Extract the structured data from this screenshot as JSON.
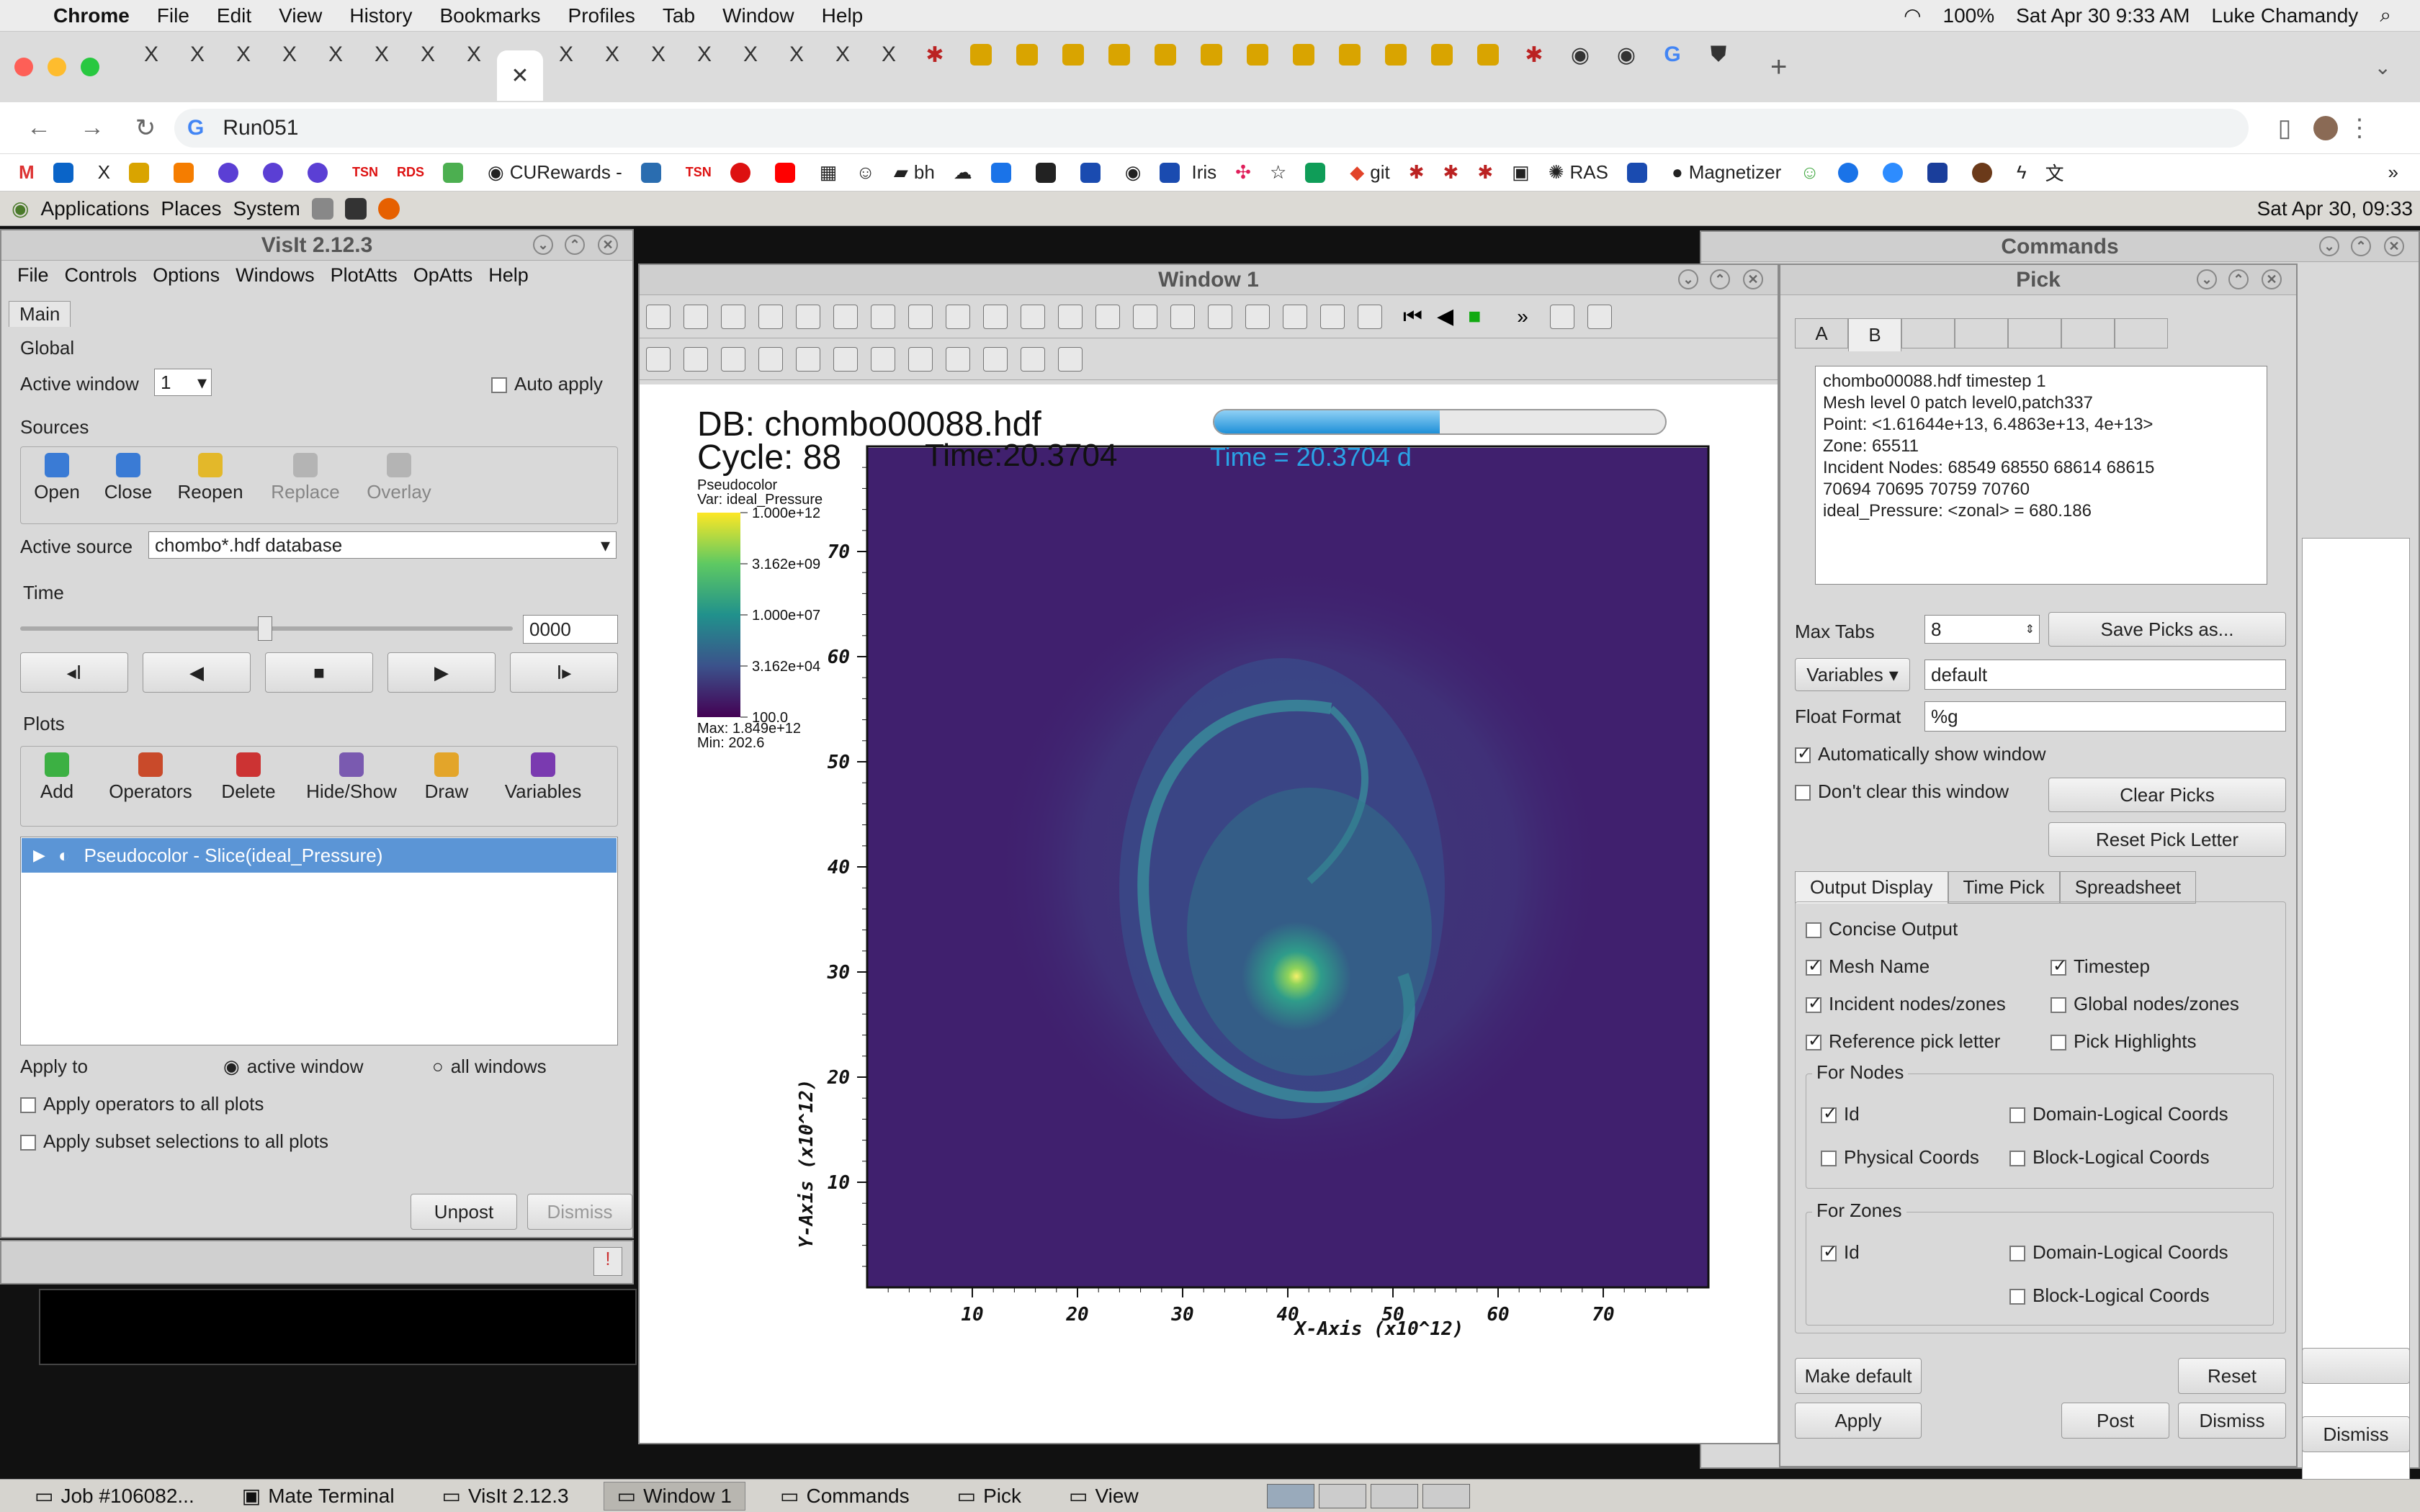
{
  "mac": {
    "menus": [
      "Chrome",
      "File",
      "Edit",
      "View",
      "History",
      "Bookmarks",
      "Profiles",
      "Tab",
      "Window",
      "Help"
    ],
    "battery": "100%",
    "datetime": "Sat Apr 30  9:33 AM",
    "user": "Luke Chamandy"
  },
  "browser": {
    "url": "Run051",
    "bookmarks": [
      "CURewards -",
      "bh",
      "Iris",
      "git",
      "RAS",
      "Magnetizer"
    ]
  },
  "mate": {
    "menus": [
      "Applications",
      "Places",
      "System"
    ],
    "clock": "Sat Apr 30, 09:33"
  },
  "visit": {
    "title": "VisIt 2.12.3",
    "menus": [
      "File",
      "Controls",
      "Options",
      "Windows",
      "PlotAtts",
      "OpAtts",
      "Help"
    ],
    "tab": "Main",
    "global": "Global",
    "active_window_label": "Active window",
    "active_window_value": "1",
    "auto_apply": "Auto apply",
    "sources": "Sources",
    "src_buttons": [
      "Open",
      "Close",
      "Reopen",
      "Replace",
      "Overlay"
    ],
    "active_source_label": "Active source",
    "active_source_value": "chombo*.hdf database",
    "time": "Time",
    "time_value": "0000",
    "plots": "Plots",
    "plot_buttons": [
      "Add",
      "Operators",
      "Delete",
      "Hide/Show",
      "Draw",
      "Variables"
    ],
    "plot_item": "Pseudocolor - Slice(ideal_Pressure)",
    "apply_to": "Apply to",
    "active_window": "active window",
    "all_windows": "all windows",
    "apply_ops": "Apply operators to all plots",
    "apply_subset": "Apply subset selections to all plots",
    "unpost": "Unpost",
    "dismiss": "Dismiss"
  },
  "window1": {
    "title": "Window 1",
    "db": "DB: chombo00088.hdf",
    "cycle": "Cycle: 88",
    "time_label": "Time:20.3704",
    "time_text": "Time = 20.3704 d",
    "legend_title": "Pseudocolor",
    "legend_var": "Var: ideal_Pressure",
    "legend_ticks": [
      "1.000e+12",
      "3.162e+09",
      "1.000e+07",
      "3.162e+04",
      "100.0"
    ],
    "legend_max": "Max: 1.849e+12",
    "legend_min": "Min: 202.6",
    "xlabel": "X-Axis  (x10^12)",
    "ylabel": "Y-Axis  (x10^12)",
    "xticks": [
      "10",
      "20",
      "30",
      "40",
      "50",
      "60",
      "70"
    ],
    "yticks": [
      "10",
      "20",
      "30",
      "40",
      "50",
      "60",
      "70"
    ],
    "progress": 0.5
  },
  "commands": {
    "title": "Commands"
  },
  "pick": {
    "title": "Pick",
    "tabs": [
      "A",
      "B"
    ],
    "output": [
      "chombo00088.hdf  timestep 1",
      "Mesh level 0 patch level0,patch337",
      "Point: <1.61644e+13, 6.4863e+13, 4e+13>",
      "Zone:  65511",
      "Incident Nodes:  68549  68550  68614  68615",
      "70694  70695  70759  70760",
      "ideal_Pressure:  <zonal> = 680.186"
    ],
    "max_tabs_label": "Max Tabs",
    "max_tabs": "8",
    "save_picks": "Save Picks as...",
    "variables": "Variables",
    "variables_value": "default",
    "float_format_label": "Float Format",
    "float_format": "%g",
    "auto_show": "Automatically show window",
    "dont_clear": "Don't clear this window",
    "clear_picks": "Clear Picks",
    "reset_letter": "Reset Pick Letter",
    "subtabs": [
      "Output Display",
      "Time Pick",
      "Spreadsheet"
    ],
    "concise": "Concise Output",
    "mesh_name": "Mesh Name",
    "timestep": "Timestep",
    "incident": "Incident nodes/zones",
    "global": "Global nodes/zones",
    "ref_letter": "Reference pick letter",
    "highlights": "Pick Highlights",
    "for_nodes": "For Nodes",
    "for_zones": "For Zones",
    "id": "Id",
    "domain_logical": "Domain-Logical Coords",
    "physical": "Physical Coords",
    "block_logical": "Block-Logical Coords",
    "make_default": "Make default",
    "reset": "Reset",
    "apply": "Apply",
    "post": "Post",
    "dismiss": "Dismiss"
  },
  "taskbar": [
    "Job #106082...",
    "Mate Terminal",
    "VisIt 2.12.3",
    "Window 1",
    "Commands",
    "Pick",
    "View"
  ],
  "colors": {
    "plot_bg": "#40206e",
    "accent": "#3b82d6"
  }
}
